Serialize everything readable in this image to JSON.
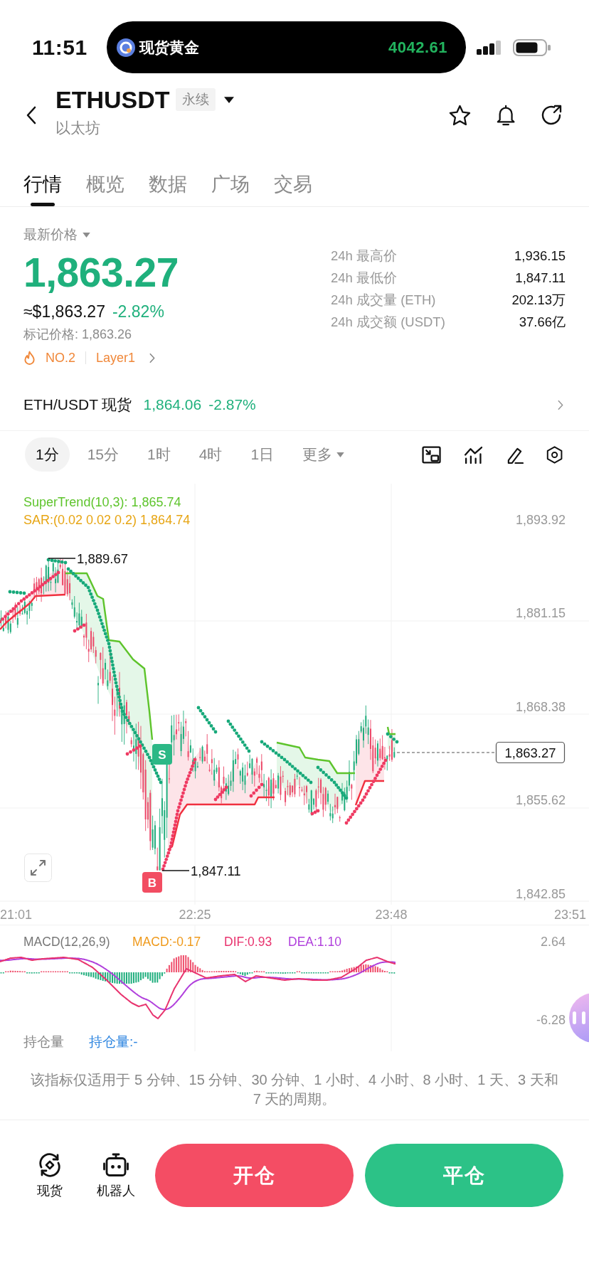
{
  "status_bar": {
    "time": "11:51",
    "live_activity": {
      "label": "现货黄金",
      "value": "4042.61"
    }
  },
  "header": {
    "symbol": "ETHUSDT",
    "badge": "永续",
    "name": "以太坊"
  },
  "tabs": [
    {
      "label": "行情",
      "selected": true
    },
    {
      "label": "概览",
      "selected": false
    },
    {
      "label": "数据",
      "selected": false
    },
    {
      "label": "广场",
      "selected": false
    },
    {
      "label": "交易",
      "selected": false
    }
  ],
  "price": {
    "selector": "最新价格",
    "last": "1,863.27",
    "usd": "≈$1,863.27",
    "change": "-2.82%",
    "mark_price": "标记价格: 1,863.26",
    "tags": [
      "NO.2",
      "Layer1"
    ]
  },
  "stats": [
    {
      "label": "24h 最高价",
      "value": "1,936.15"
    },
    {
      "label": "24h 最低价",
      "value": "1,847.11"
    },
    {
      "label": "24h 成交量 (ETH)",
      "value": "202.13万"
    },
    {
      "label": "24h 成交额 (USDT)",
      "value": "37.66亿"
    }
  ],
  "spot": {
    "label": "ETH/USDT 现货",
    "price": "1,864.06",
    "change": "-2.87%"
  },
  "intervals": [
    {
      "label": "1分",
      "selected": true
    },
    {
      "label": "15分",
      "selected": false
    },
    {
      "label": "1时",
      "selected": false
    },
    {
      "label": "4时",
      "selected": false
    },
    {
      "label": "1日",
      "selected": false
    }
  ],
  "interval_more": {
    "label": "更多"
  },
  "chart": {
    "legend": [
      {
        "text": "SuperTrend(10,3): 1,865.74",
        "color": "#5ec42c"
      },
      {
        "text": "SAR:(0.02 0.02 0.2) 1,864.74",
        "color": "#e7a513"
      }
    ],
    "price_axis": [
      "1,893.92",
      "1,881.15",
      "1,868.38",
      "1,855.62",
      "1,842.85"
    ],
    "time_axis": [
      "21:01",
      "22:25",
      "23:48",
      "23:51"
    ],
    "high_label": "1,889.67",
    "low_label": "1,847.11",
    "current_price": "1,863.27",
    "markers": [
      {
        "label": "S",
        "color": "#2bb886"
      },
      {
        "label": "B",
        "color": "#f24d62"
      }
    ]
  },
  "macd": {
    "legend": [
      {
        "text": "MACD(12,26,9)",
        "color": "#777777"
      },
      {
        "text": "MACD:-0.17",
        "color": "#ef9a1c"
      },
      {
        "text": "DIF:0.93",
        "color": "#e8336e"
      },
      {
        "text": "DEA:1.10",
        "color": "#b03fdc"
      }
    ],
    "axis": [
      "2.64",
      "-6.28"
    ]
  },
  "open_interest": {
    "title": "持仓量",
    "value": "持仓量:-"
  },
  "note": "该指标仅适用于 5 分钟、15 分钟、30 分钟、1 小时、4 小时、8 小时、1 天、3 天和 7 天的周期。",
  "bottom_nav": [
    {
      "label": "现货"
    },
    {
      "label": "机器人"
    }
  ],
  "trade_buttons": [
    {
      "label": "开仓",
      "color": "#f44d64"
    },
    {
      "label": "平仓",
      "color": "#2cc287"
    }
  ]
}
